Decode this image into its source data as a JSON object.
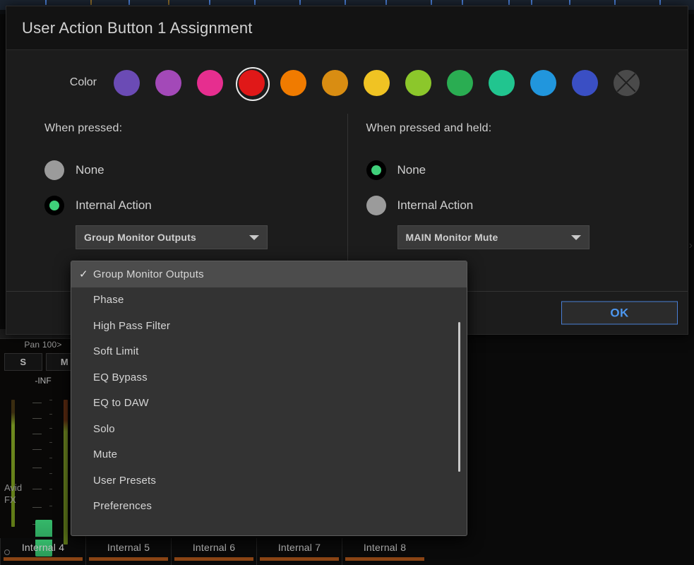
{
  "dialog": {
    "title": "User Action Button 1 Assignment",
    "color_label": "Color",
    "ok_label": "OK",
    "colors": [
      {
        "name": "purple",
        "hex": "#6b4bb5"
      },
      {
        "name": "violet",
        "hex": "#a349b8"
      },
      {
        "name": "pink",
        "hex": "#e62e8f"
      },
      {
        "name": "red",
        "hex": "#e01818"
      },
      {
        "name": "orange",
        "hex": "#f07b00"
      },
      {
        "name": "amber",
        "hex": "#d98d12"
      },
      {
        "name": "yellow",
        "hex": "#f0c323"
      },
      {
        "name": "lime",
        "hex": "#8cc72b"
      },
      {
        "name": "green",
        "hex": "#2aad52"
      },
      {
        "name": "teal",
        "hex": "#21c58f"
      },
      {
        "name": "light-blue",
        "hex": "#2196dd"
      },
      {
        "name": "blue",
        "hex": "#3a4fc4"
      },
      {
        "name": "none",
        "hex": "#4a4a4a"
      }
    ],
    "selected_color_index": 3,
    "when_pressed": {
      "heading": "When pressed:",
      "option_none": "None",
      "option_internal_action": "Internal Action",
      "selected_option": "Internal Action",
      "combo_value": "Group Monitor Outputs"
    },
    "when_pressed_and_held": {
      "heading": "When pressed and held:",
      "option_none": "None",
      "option_internal_action": "Internal Action",
      "selected_option": "None",
      "combo_value": "MAIN Monitor Mute"
    }
  },
  "menu": {
    "checked_index": 0,
    "items": [
      "Group Monitor Outputs",
      "Phase",
      "High Pass Filter",
      "Soft Limit",
      "EQ Bypass",
      "EQ to DAW",
      "Solo",
      "Mute",
      "User Presets",
      "Preferences"
    ],
    "clipped_item": ""
  },
  "background": {
    "channel": {
      "pan": "Pan 100>",
      "solo": "S",
      "mute": "M",
      "level": "-INF",
      "insert_line1": "Avid",
      "insert_line2": "FX"
    },
    "channel_names": [
      "Internal 4",
      "Internal 5",
      "Internal 6",
      "Internal 7",
      "Internal 8"
    ],
    "edge_chevron": "›"
  }
}
